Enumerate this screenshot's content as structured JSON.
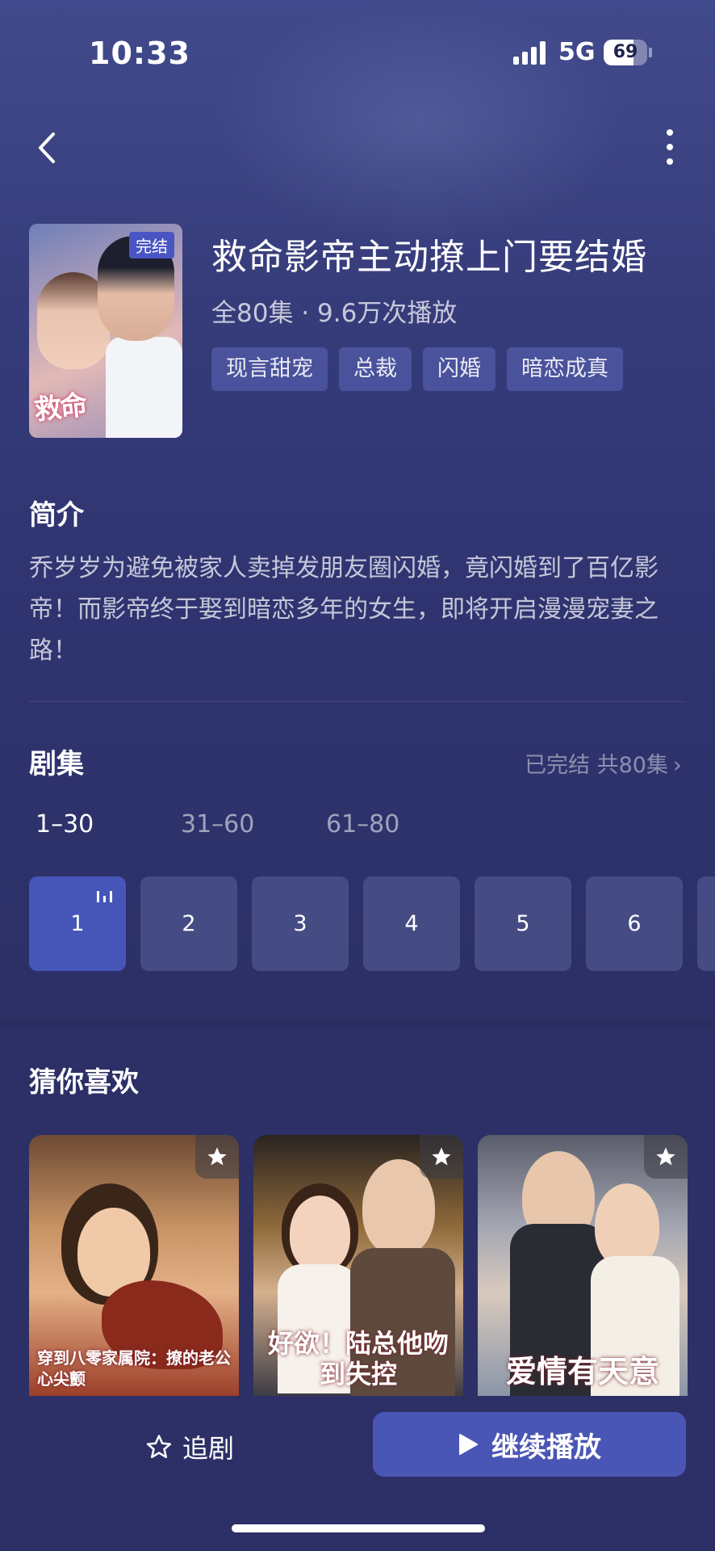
{
  "status_bar": {
    "time": "10:33",
    "network": "5G",
    "battery": "69",
    "battery_level": 0.69
  },
  "nav": {
    "back_icon": "chevron-left-icon",
    "more_icon": "more-vertical-icon"
  },
  "drama": {
    "poster_badge": "完结",
    "title": "救命影帝主动撩上门要结婚",
    "meta": "全80集 · 9.6万次播放",
    "tags": [
      "现言甜宠",
      "总裁",
      "闪婚",
      "暗恋成真"
    ]
  },
  "intro": {
    "heading": "简介",
    "text": "乔岁岁为避免被家人卖掉发朋友圈闪婚，竟闪婚到了百亿影帝！而影帝终于娶到暗恋多年的女生，即将开启漫漫宠妻之路！"
  },
  "episodes": {
    "heading": "剧集",
    "status": "已完结 共80集",
    "ranges": [
      "1–30",
      "31–60",
      "61–80"
    ],
    "active_range": 0,
    "items": [
      "1",
      "2",
      "3",
      "4",
      "5",
      "6"
    ],
    "current": "1"
  },
  "recommend": {
    "heading": "猜你喜欢",
    "items": [
      {
        "caption": "穿到八零家属院：撩的老公心尖颤"
      },
      {
        "caption": "好欲！陆总他吻到失控"
      },
      {
        "caption": "爱情有天意"
      }
    ]
  },
  "actions": {
    "follow_label": "追剧",
    "continue_label": "继续播放"
  },
  "colors": {
    "background": "#2c3066",
    "accent": "#4a56b5",
    "tag_bg": "#4a52a0"
  }
}
